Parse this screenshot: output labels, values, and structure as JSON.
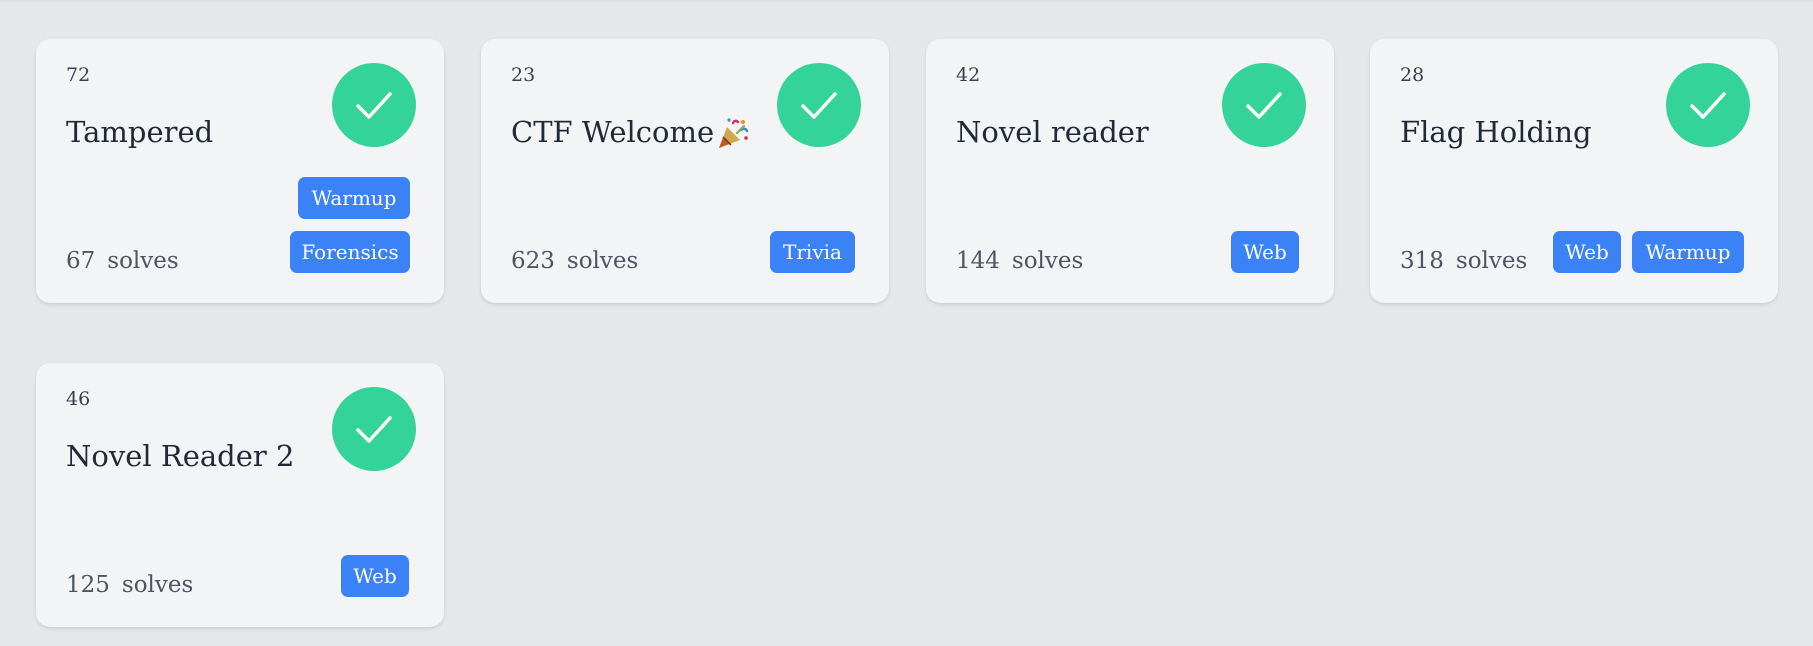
{
  "challenges": [
    {
      "points": "72",
      "title": "Tampered",
      "solves_count": "67",
      "solves_label": "solves",
      "solved": true,
      "tags": [
        "Warmup",
        "Forensics"
      ]
    },
    {
      "points": "23",
      "title": "CTF Welcome",
      "title_emoji": "party-popper",
      "solves_count": "623",
      "solves_label": "solves",
      "solved": true,
      "tags": [
        "Trivia"
      ]
    },
    {
      "points": "42",
      "title": "Novel reader",
      "solves_count": "144",
      "solves_label": "solves",
      "solved": true,
      "tags": [
        "Web"
      ]
    },
    {
      "points": "28",
      "title": "Flag Holding",
      "solves_count": "318",
      "solves_label": "solves",
      "solved": true,
      "tags": [
        "Web",
        "Warmup"
      ]
    },
    {
      "points": "46",
      "title": "Novel Reader 2",
      "solves_count": "125",
      "solves_label": "solves",
      "solved": true,
      "tags": [
        "Web"
      ]
    }
  ],
  "colors": {
    "background": "#e5e7eb",
    "card": "#f3f4f6",
    "solved_check": "#34d399",
    "tag": "#3b82f6"
  },
  "icons": {
    "solved": "check-icon",
    "emoji": "party-popper-icon"
  }
}
